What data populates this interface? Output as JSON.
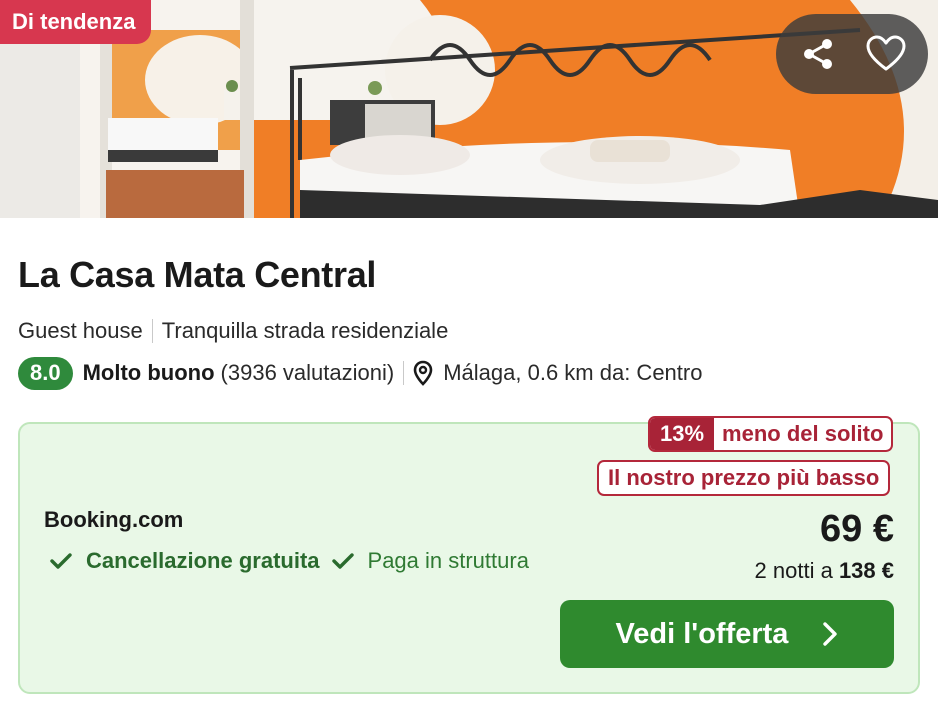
{
  "hero": {
    "badge": "Di tendenza",
    "share_icon": "share-icon",
    "favorite_icon": "heart-outline-icon"
  },
  "hotel": {
    "name": "La Casa Mata Central",
    "type": "Guest house",
    "street": "Tranquilla strada residenziale",
    "score": "8.0",
    "rating_word": "Molto buono",
    "reviews": "(3936 valutazioni)",
    "location_icon": "map-pin-icon",
    "location": "Málaga, 0.6 km da: Centro"
  },
  "offer": {
    "discount_pct": "13%",
    "discount_text": "meno del solito",
    "lowest_label": "Il nostro prezzo più basso",
    "provider": "Booking.com",
    "features": [
      {
        "label": "Cancellazione gratuita",
        "icon": "check-icon"
      },
      {
        "label": "Paga in struttura",
        "icon": "check-icon"
      }
    ],
    "price": "69 €",
    "total_prefix": "2 notti a",
    "total_price": "138 €",
    "cta": "Vedi l'offerta",
    "cta_icon": "chevron-right-icon"
  },
  "colors": {
    "badge_red": "#d7374f",
    "score_green": "#2f8a3c",
    "deal_bg": "#e9f8e7",
    "discount_red": "#a82337",
    "cta_green": "#2f8a2e"
  }
}
